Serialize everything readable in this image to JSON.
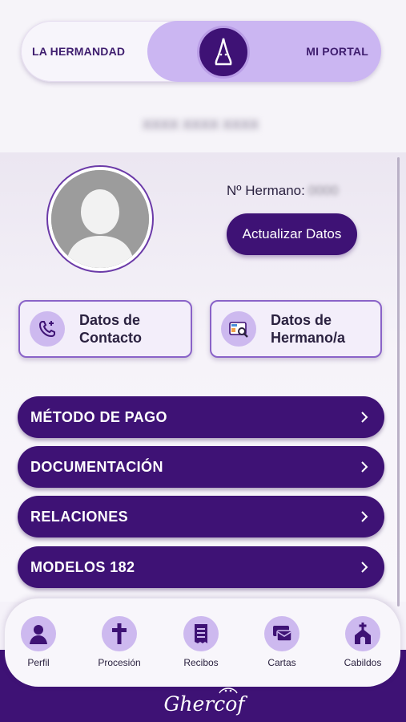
{
  "segment": {
    "left_label": "LA HERMANDAD",
    "right_label": "MI PORTAL",
    "knob_icon": "hood-icon"
  },
  "profile": {
    "name_blurred": "XXXX XXXX XXXX",
    "hermano_label": "Nº Hermano:",
    "hermano_value": "0000",
    "update_button": "Actualizar Datos"
  },
  "cards": [
    {
      "label_line1": "Datos de",
      "label_line2": "Contacto",
      "icon": "phone-add-icon"
    },
    {
      "label_line1": "Datos de",
      "label_line2": "Hermano/a",
      "icon": "id-card-search-icon"
    }
  ],
  "menu": [
    {
      "label": "MÉTODO DE PAGO"
    },
    {
      "label": "DOCUMENTACIÓN"
    },
    {
      "label": "RELACIONES"
    },
    {
      "label": "MODELOS 182"
    }
  ],
  "nav": [
    {
      "label": "Perfil",
      "icon": "user-icon"
    },
    {
      "label": "Procesión",
      "icon": "cross-icon"
    },
    {
      "label": "Recibos",
      "icon": "receipt-icon"
    },
    {
      "label": "Cartas",
      "icon": "mail-icon"
    },
    {
      "label": "Cabildos",
      "icon": "church-icon"
    }
  ],
  "brand": "Ghercof",
  "colors": {
    "primary": "#3e1275",
    "accent_light": "#cbb6f2",
    "icon_bg": "#cdb9ef",
    "card_border": "#8a63c8"
  }
}
